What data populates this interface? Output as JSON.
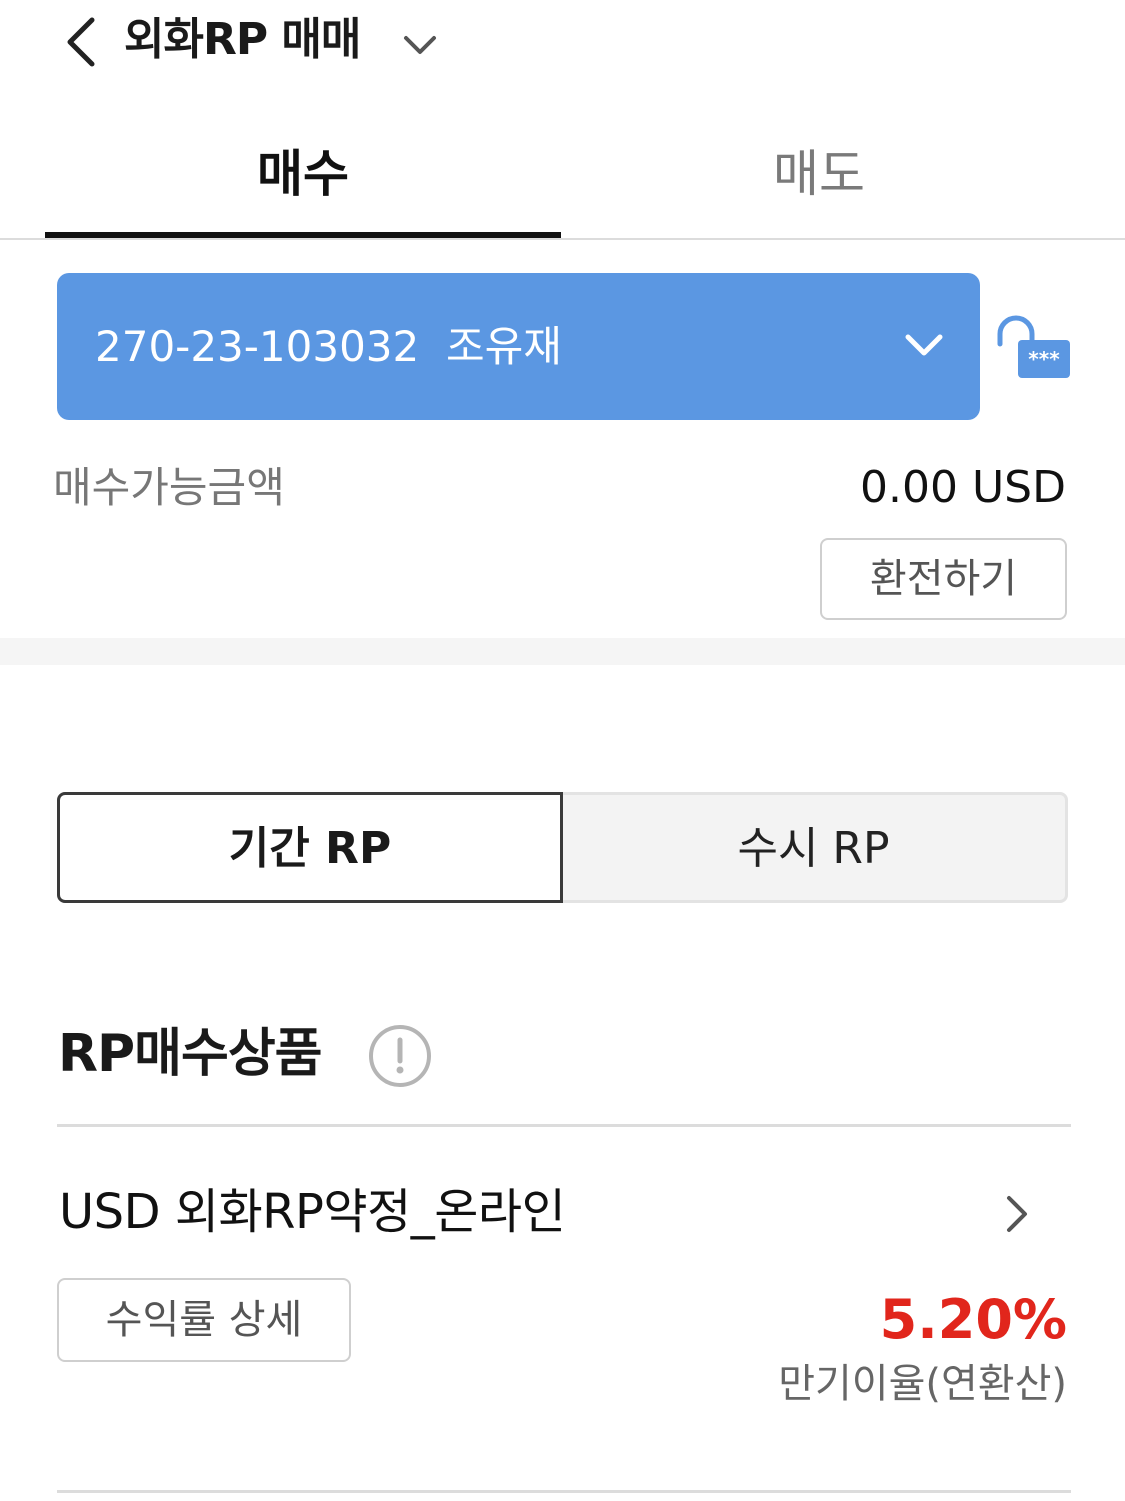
{
  "header": {
    "title": "외화RP 매매"
  },
  "tabs": [
    {
      "label": "매수",
      "active": true
    },
    {
      "label": "매도",
      "active": false
    }
  ],
  "account": {
    "number": "270-23-103032",
    "holder": "조유재",
    "display": "270-23-103032  조유재",
    "bg_color": "#5b97e2"
  },
  "lock": {
    "icon": "unlock-password-icon",
    "mask": "***",
    "color": "#5b97e2"
  },
  "available": {
    "label": "매수가능금액",
    "value": "0.00 USD"
  },
  "exchange_button": "환전하기",
  "segment": {
    "options": [
      "기간 RP",
      "수시 RP"
    ],
    "selected": "기간 RP"
  },
  "products": {
    "title": "RP매수상품",
    "items": [
      {
        "name": "USD 외화RP약정_온라인",
        "yield_button": "수익률 상세",
        "rate": "5.20%",
        "rate_label": "만기이율(연환산)",
        "rate_color": "#e1261c"
      }
    ]
  }
}
